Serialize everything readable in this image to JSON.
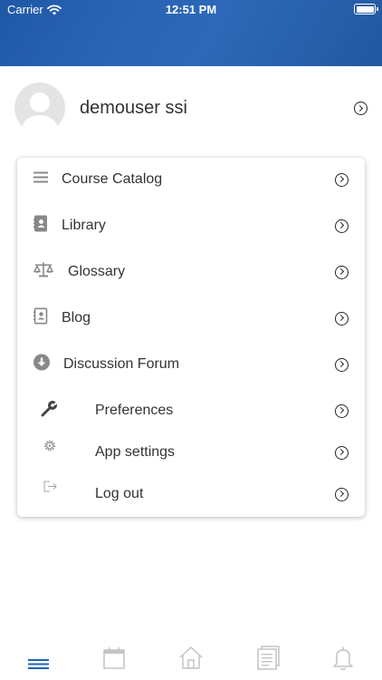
{
  "status": {
    "carrier": "Carrier",
    "time": "12:51 PM"
  },
  "colors": {
    "header_blue": "#2a64b4",
    "tab_active": "#1f63b4",
    "tab_inactive": "#c4c4c4",
    "icon_gray": "#888888"
  },
  "profile": {
    "name": "demouser ssi"
  },
  "menu": {
    "items": [
      {
        "label": "Course Catalog",
        "icon": "list-icon"
      },
      {
        "label": "Library",
        "icon": "address-book-icon"
      },
      {
        "label": "Glossary",
        "icon": "balance-scale-icon"
      },
      {
        "label": "Blog",
        "icon": "contact-card-icon"
      },
      {
        "label": "Discussion Forum",
        "icon": "download-circle-icon"
      },
      {
        "label": "Preferences",
        "icon": "wrench-icon"
      },
      {
        "label": "App settings",
        "icon": "gear-icon"
      },
      {
        "label": "Log out",
        "icon": "logout-icon"
      }
    ]
  },
  "tabbar": {
    "tabs": [
      {
        "name": "menu-tab",
        "icon": "hamburger-icon",
        "active": true
      },
      {
        "name": "calendar-tab",
        "icon": "calendar-icon",
        "active": false
      },
      {
        "name": "home-tab",
        "icon": "home-icon",
        "active": false
      },
      {
        "name": "courses-tab",
        "icon": "document-icon",
        "active": false
      },
      {
        "name": "notifications-tab",
        "icon": "bell-icon",
        "active": false
      }
    ]
  }
}
